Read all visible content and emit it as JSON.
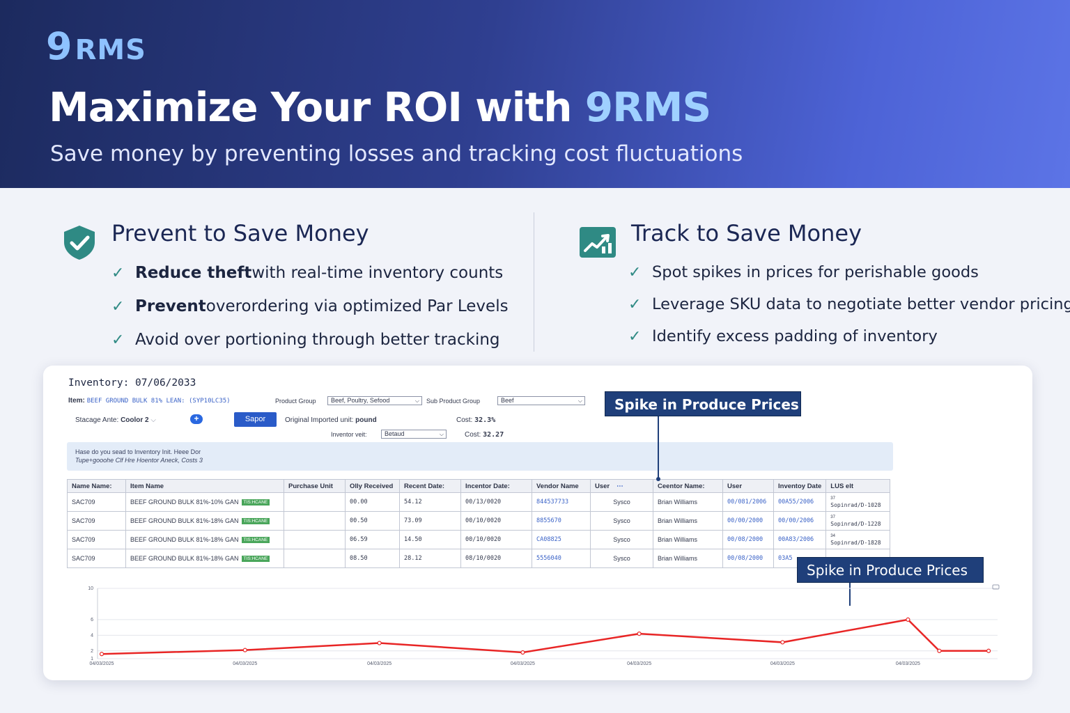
{
  "hero": {
    "logo_nine": "9",
    "logo_rms": "RMS",
    "title_prefix": "Maximize Your ROI with ",
    "title_accent": "9RMS",
    "subtitle": "Save money by preventing losses and tracking cost fluctuations",
    "accent_color": "#9fd0ff"
  },
  "features": {
    "left": {
      "icon": "shield-check-icon",
      "title": "Prevent to Save Money",
      "items": [
        {
          "bold": "Reduce theft",
          "rest": " with real-time inventory counts"
        },
        {
          "bold": "Prevent",
          "rest": " overordering via optimized Par Levels"
        },
        {
          "bold": "",
          "rest": "Avoid over portioning through better tracking"
        }
      ]
    },
    "right": {
      "icon": "trend-chart-icon",
      "title": "Track to Save Money",
      "items": [
        "Spot spikes in prices for perishable goods",
        "Leverage SKU data to negotiate better vendor pricing",
        "Identify excess padding of inventory"
      ]
    },
    "check_glyph": "✓",
    "check_color": "#2f8a84"
  },
  "inventory": {
    "title": "Inventory: 07/06/2033",
    "item_label": "Item:",
    "item_value": "BEEF GROUND BULK 81% LEAN: (SYP10LC35)",
    "product_group_label": "Product Group",
    "product_group_value": "Beef, Poultry, Sefood",
    "sub_product_group_label": "Sub Product Group",
    "sub_product_group_value": "Beef",
    "storage_label": "Stacage Ante:",
    "storage_value": "Coolor 2",
    "plus_label": "+",
    "sapor_label": "Sapor",
    "original_unit_label": "Original Imported unit:",
    "original_unit_value": "pound",
    "cost1_label": "Cost:",
    "cost1_value": "32.3%",
    "inventory_unit_label": "Inventor veit:",
    "inventory_unit_value": "Betaud",
    "cost2_label": "Cost:",
    "cost2_value": "32.27",
    "notice_line1": "Hase do you sead to Inventory Init. Heee Dor",
    "notice_line2": "Tupe+gooohe Clf Hre Hoentor Aneck, Costs 3"
  },
  "table": {
    "headers": [
      "Name Name:",
      "Item Name",
      "Purchase Unit",
      "Olly Received",
      "Recent Date:",
      "Incentor Date:",
      "Vendor Name",
      "User",
      "Ceentor Name:",
      "User",
      "Inventoy Date",
      "LUS elt"
    ],
    "rows": [
      {
        "code": "SAC709",
        "item": "BEEF GROUND BULK 81%-10% GAN",
        "tag": "TIS:HCANE",
        "purchase": "",
        "qty": "00.00",
        "recent": "54.12",
        "inv_date": "00/13/0020",
        "vendor_no": "844537733",
        "vendor": "Sysco",
        "user": "Brian Williams",
        "date1": "00/081/2006",
        "date2": "00A55/2006",
        "last1": "37",
        "last2": "Sopinrad/D-1028"
      },
      {
        "code": "SAC709",
        "item": "BEEF GROUND BULK 81%-18% GAN",
        "tag": "TIS:HCANE",
        "purchase": "",
        "qty": "00.50",
        "recent": "73.09",
        "inv_date": "00/10/0020",
        "vendor_no": "8855670",
        "vendor": "Sysco",
        "user": "Brian Williams",
        "date1": "00/00/2000",
        "date2": "00/00/2006",
        "last1": "37",
        "last2": "Sopinrad/D-1228"
      },
      {
        "code": "SAC709",
        "item": "BEEF GROUND BULK 81%-18% GAN",
        "tag": "TIS:HCANE",
        "purchase": "",
        "qty": "06.59",
        "recent": "14.50",
        "inv_date": "00/10/0020",
        "vendor_no": "CA08825",
        "vendor": "Sysco",
        "user": "Brian Williams",
        "date1": "00/08/2000",
        "date2": "00A83/2006",
        "last1": "34",
        "last2": "Sopinrad/D-1828"
      },
      {
        "code": "SAC709",
        "item": "BEEF GROUND BULK 81%-18% GAN",
        "tag": "TIS:HCANE",
        "purchase": "",
        "qty": "08.50",
        "recent": "28.12",
        "inv_date": "08/10/0020",
        "vendor_no": "5556040",
        "vendor": "Sysco",
        "user": "Brian Williams",
        "date1": "00/08/2000",
        "date2": "03A5",
        "last1": "",
        "last2": ""
      }
    ]
  },
  "callouts": {
    "top": "Spike in Produce Prices",
    "bottom": "Spike in Produce Prices",
    "color": "#1f3f7a"
  },
  "chart_data": {
    "type": "line",
    "x": [
      "04/03/2025",
      "04/03/2025",
      "04/03/2025",
      "04/03/2025",
      "04/03/2025",
      "04/03/2025",
      "04/03/2025"
    ],
    "y_positions_x": [
      0,
      1.6,
      3.1,
      4.7,
      6.0,
      7.6,
      9.0
    ],
    "series": [
      {
        "values": [
          1.6,
          2.1,
          3.0,
          1.8,
          4.2,
          3.1,
          6.0,
          2.0,
          2.0
        ],
        "x_at": [
          0,
          1.6,
          3.1,
          4.7,
          6.0,
          7.6,
          9.0,
          9.35,
          9.9
        ],
        "color": "#e82525"
      }
    ],
    "ytick_labels": [
      "1",
      "2",
      "4",
      "6",
      "10"
    ],
    "ytick_values": [
      1,
      2,
      4,
      6,
      10
    ],
    "ylim": [
      1,
      10
    ],
    "grid": true,
    "title": "",
    "xlabel": "",
    "ylabel": ""
  }
}
